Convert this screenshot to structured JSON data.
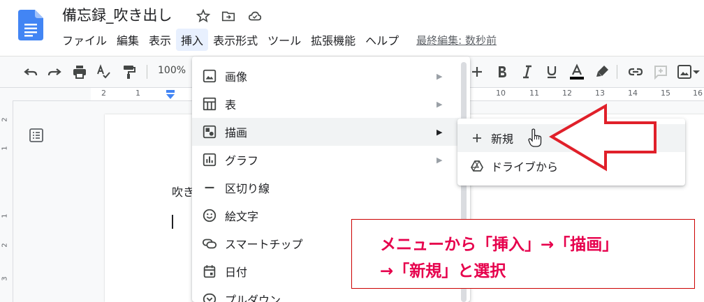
{
  "document": {
    "title": "備忘録_吹き出し",
    "body_text": "吹き"
  },
  "menubar": {
    "items": [
      "ファイル",
      "編集",
      "表示",
      "挿入",
      "表示形式",
      "ツール",
      "拡張機能",
      "ヘルプ"
    ],
    "active_index": 3,
    "last_edit": "最終編集: 数秒前"
  },
  "toolbar": {
    "zoom": "100%",
    "icons": [
      "undo-icon",
      "redo-icon",
      "print-icon",
      "spellcheck-icon",
      "paint-format-icon",
      "plus-icon",
      "bold-icon",
      "italic-icon",
      "underline-icon",
      "text-color-icon",
      "highlight-icon",
      "link-icon",
      "comment-icon",
      "image-icon"
    ]
  },
  "ruler": {
    "left_numbers": [
      "2",
      "1"
    ],
    "right_numbers": [
      "10",
      "11",
      "12",
      "13",
      "14",
      "15",
      "16"
    ],
    "vertical_numbers": [
      "2",
      "1",
      "1",
      "2",
      "3"
    ]
  },
  "insert_menu": {
    "items": [
      {
        "label": "画像",
        "icon": "image-icon",
        "has_submenu": true
      },
      {
        "label": "表",
        "icon": "table-icon",
        "has_submenu": true
      },
      {
        "label": "描画",
        "icon": "drawing-icon",
        "has_submenu": true,
        "highlighted": true
      },
      {
        "label": "グラフ",
        "icon": "chart-icon",
        "has_submenu": true
      },
      {
        "label": "区切り線",
        "icon": "horizontal-line-icon",
        "has_submenu": false
      },
      {
        "label": "絵文字",
        "icon": "emoji-icon",
        "has_submenu": false
      },
      {
        "label": "スマートチップ",
        "icon": "smart-chip-icon",
        "has_submenu": false
      },
      {
        "label": "日付",
        "icon": "calendar-icon",
        "has_submenu": false
      },
      {
        "label": "プルダウン",
        "icon": "dropdown-icon",
        "has_submenu": false
      }
    ]
  },
  "drawing_submenu": {
    "items": [
      {
        "label": "新規",
        "icon": "plus-icon",
        "highlighted": true
      },
      {
        "label": "ドライブから",
        "icon": "drive-icon"
      }
    ]
  },
  "annotation": {
    "line1": "メニューから「挿入」→「描画」",
    "line2": "→「新規」と選択",
    "color": "#e6004c"
  },
  "colors": {
    "doc_icon": "#4285f4",
    "arrow": "#e0202a",
    "menu_highlight": "#e8f0fe"
  }
}
